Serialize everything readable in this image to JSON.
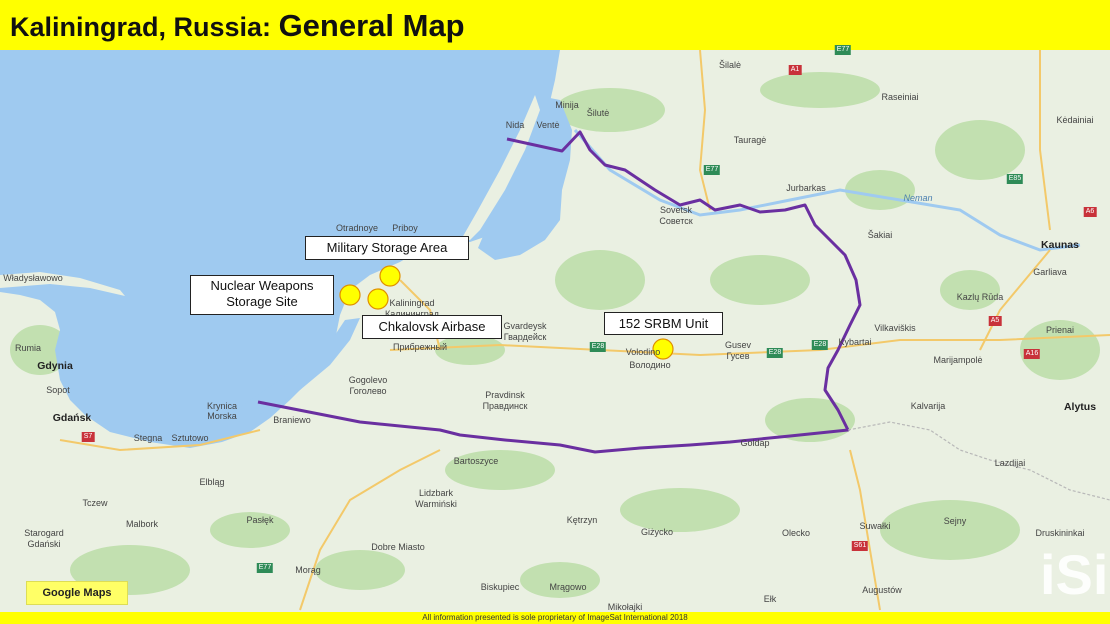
{
  "title": {
    "prefix": "Kaliningrad, Russia: ",
    "main": "General Map"
  },
  "map_provider": "Google Maps",
  "footer": "All information presented is sole proprietary of ImageSat International 2018",
  "callouts": {
    "military_storage": "Military Storage Area",
    "nuclear_line1": "Nuclear Weapons",
    "nuclear_line2": "Storage Site",
    "airbase": "Chkalovsk Airbase",
    "srbm": "152 SRBM Unit"
  },
  "markers": [
    {
      "name": "military-storage-marker",
      "target": "Military Storage Area"
    },
    {
      "name": "nuclear-site-marker",
      "target": "Nuclear Weapons Storage Site"
    },
    {
      "name": "airbase-marker",
      "target": "Chkalovsk Airbase"
    },
    {
      "name": "srbm-marker",
      "target": "152 SRBM Unit"
    }
  ],
  "places": {
    "silale": "Šilalė",
    "raseiniai": "Raseiniai",
    "kedainiai": "Kėdainiai",
    "silute": "Šilutė",
    "minija": "Minija",
    "nida": "Nida",
    "vente": "Ventė",
    "taurage": "Tauragė",
    "jurbarkas": "Jurbarkas",
    "sovetsk": "Sovetsk",
    "sovetsk_ru": "Советск",
    "neman": "Neman",
    "sakiai": "Šakiai",
    "kaunas": "Kaunas",
    "garliava": "Garliava",
    "kazlu_ruda": "Kazlų Rūda",
    "otradnoye": "Otradnoye",
    "priboy": "Priboy",
    "wladyslawowo": "Władysławowo",
    "kaliningrad": "Kaliningrad",
    "kaliningrad_ru": "Калининград",
    "gvardeysk": "Gvardeysk",
    "gvardeysk_ru": "Гвардейск",
    "pribrezhny": "Прибрежный",
    "volodino": "Volodino",
    "volodino_ru": "Володино",
    "gusev": "Gusev",
    "gusev_ru": "Гусев",
    "kybartai": "Kybartai",
    "vilkaviskis": "Vilkaviškis",
    "prienai": "Prienai",
    "marijampole": "Marijampolė",
    "rumia": "Rumia",
    "gdynia": "Gdynia",
    "sopot": "Sopot",
    "gdansk": "Gdańsk",
    "gogolevo": "Gogolevo",
    "gogolevo_ru": "Гоголево",
    "pravdinsk": "Pravdinsk",
    "pravdinsk_ru": "Правдинск",
    "krynica": "Krynica",
    "morska": "Morska",
    "braniewo": "Braniewo",
    "stegna": "Stegna",
    "sztutowo": "Sztutowo",
    "kalvarija": "Kalvarija",
    "alytus": "Alytus",
    "goldap": "Goldap",
    "bartoszyce": "Bartoszyce",
    "elblag": "Elbląg",
    "lidzbark": "Lidzbark",
    "warminski": "Warmiński",
    "tczew": "Tczew",
    "malbork": "Malbork",
    "starogard": "Starogard",
    "gdanski": "Gdański",
    "paslek": "Pasłęk",
    "ketrzyn": "Kętrzyn",
    "gizycko": "Giżycko",
    "olecko": "Olecko",
    "suwalki": "Suwałki",
    "sejny": "Sejny",
    "lazdijai": "Lazdijai",
    "druskininkai": "Druskininkai",
    "dobre_miasto": "Dobre Miasto",
    "morag": "Morąg",
    "biskupiec": "Biskupiec",
    "mragowo": "Mrągowo",
    "mikolajki": "Mikołajki",
    "elk": "Ełk",
    "augustow": "Augustów"
  },
  "roads": {
    "a1": "A1",
    "e77_top": "E77",
    "e77_mid": "E77",
    "e85": "E85",
    "a6": "A6",
    "a5": "A5",
    "a16": "A16",
    "e28_a": "E28",
    "e28_b": "E28",
    "e28_c": "E28",
    "s7": "S7",
    "e77_bot": "E77",
    "s61": "S61"
  },
  "colors": {
    "banner": "#ffff00",
    "water": "#9fcaf0",
    "land": "#eaf0e2",
    "forest": "#c2e0b0",
    "border_line": "#6a2fa0",
    "marker_fill": "#ffff00",
    "marker_stroke": "#e09000"
  }
}
